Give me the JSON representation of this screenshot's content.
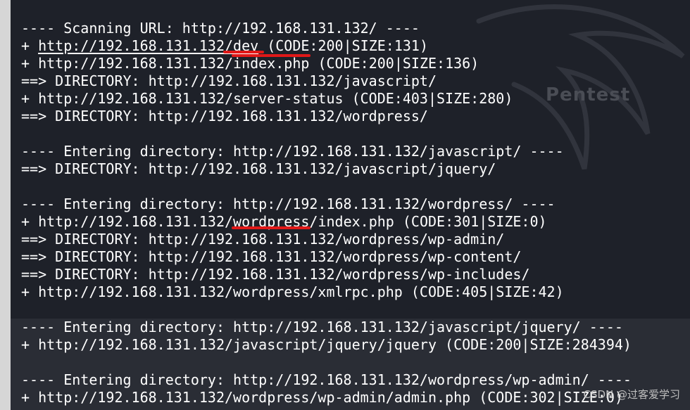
{
  "terminal": {
    "lines": [
      {
        "text": "---- Scanning URL: http://192.168.131.132/ ----"
      },
      {
        "pre": "+ ",
        "mark": "http://192.168.131.132/dev",
        "post": " (CODE:200|SIZE:131)"
      },
      {
        "pre": "+ http://192.168.131.132/",
        "mark": "index.php",
        "post": " (CODE:200|SIZE:136)"
      },
      {
        "text": "==> DIRECTORY: http://192.168.131.132/javascript/"
      },
      {
        "text": "+ http://192.168.131.132/server-status (CODE:403|SIZE:280)"
      },
      {
        "text": "==> DIRECTORY: http://192.168.131.132/wordpress/"
      },
      {
        "text": ""
      },
      {
        "text": "---- Entering directory: http://192.168.131.132/javascript/ ----"
      },
      {
        "text": "==> DIRECTORY: http://192.168.131.132/javascript/jquery/"
      },
      {
        "text": ""
      },
      {
        "text": "---- Entering directory: http://192.168.131.132/wordpress/ ----"
      },
      {
        "pre": "+ http://192.168.131.132/",
        "mark": "wordpress",
        "post": "/index.php (CODE:301|SIZE:0)"
      },
      {
        "text": "==> DIRECTORY: http://192.168.131.132/wordpress/wp-admin/"
      },
      {
        "text": "==> DIRECTORY: http://192.168.131.132/wordpress/wp-content/"
      },
      {
        "text": "==> DIRECTORY: http://192.168.131.132/wordpress/wp-includes/"
      },
      {
        "text": "+ http://192.168.131.132/wordpress/xmlrpc.php (CODE:405|SIZE:42)"
      },
      {
        "text": ""
      },
      {
        "text": "---- Entering directory: http://192.168.131.132/javascript/jquery/ ----"
      },
      {
        "text": "+ http://192.168.131.132/javascript/jquery/jquery (CODE:200|SIZE:284394)"
      },
      {
        "text": ""
      },
      {
        "text": "---- Entering directory: http://192.168.131.132/wordpress/wp-admin/ ----"
      },
      {
        "text": "+ http://192.168.131.132/wordpress/wp-admin/admin.php (CODE:302|SIZE:0)"
      }
    ],
    "background_watermark": "Pentest",
    "corner_watermark": "CSDN @过客爱学习"
  },
  "colors": {
    "background": "#1e2129",
    "text": "#ffffff",
    "annotation": "#e01818"
  }
}
